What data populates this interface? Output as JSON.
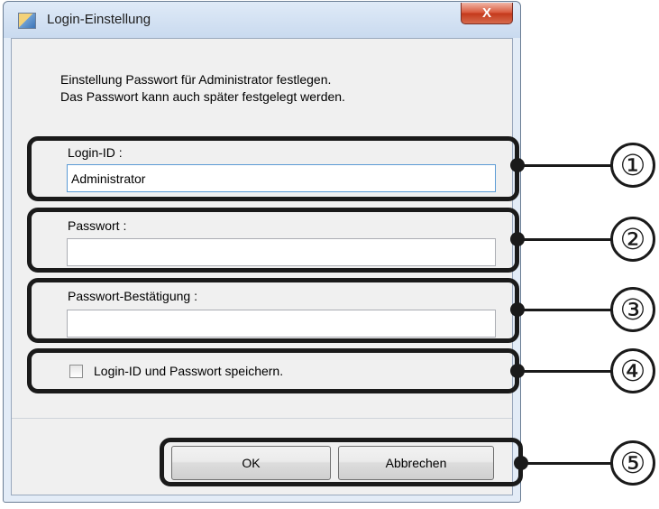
{
  "window": {
    "title": "Login-Einstellung",
    "close_label": "X"
  },
  "info": {
    "line1": "Einstellung Passwort für Administrator festlegen.",
    "line2": "Das Passwort kann auch später festgelegt werden."
  },
  "fields": {
    "login_id": {
      "label": "Login-ID :",
      "value": "Administrator"
    },
    "password": {
      "label": "Passwort :",
      "value": ""
    },
    "confirm": {
      "label": "Passwort-Bestätigung :",
      "value": ""
    }
  },
  "checkbox": {
    "label": "Login-ID und Passwort speichern.",
    "checked": false
  },
  "buttons": {
    "ok": "OK",
    "cancel": "Abbrechen"
  },
  "callouts": [
    "①",
    "②",
    "③",
    "④",
    "⑤"
  ],
  "icons": {
    "title_icon": "login-settings-icon",
    "close_icon": "close-icon"
  },
  "colors": {
    "close_button": "#c4391b",
    "focus_border": "#5b9bd5",
    "callout": "#1a1a1a"
  }
}
